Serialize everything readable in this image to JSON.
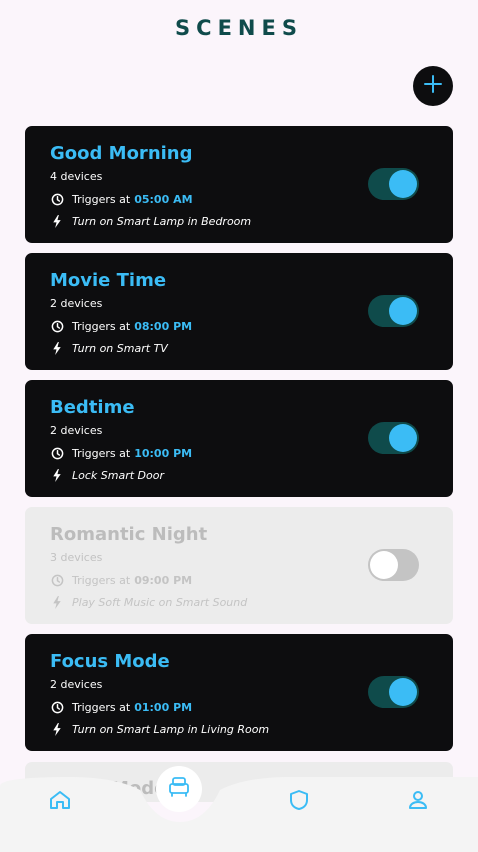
{
  "header": {
    "title": "SCENES"
  },
  "add_button": {
    "icon": "plus-icon",
    "label": "+"
  },
  "colors": {
    "accent": "#3bbcf5",
    "card_bg": "#0d0d0f",
    "toggle_on_track": "#0f4b4b",
    "disabled_bg": "#ececec"
  },
  "scenes": [
    {
      "name": "Good Morning",
      "devices": "4 devices",
      "trigger_prefix": "Triggers at",
      "time": "05:00 AM",
      "action": "Turn on Smart Lamp in Bedroom",
      "enabled": true
    },
    {
      "name": "Movie Time",
      "devices": "2 devices",
      "trigger_prefix": "Triggers at",
      "time": "08:00 PM",
      "action": "Turn on Smart TV",
      "enabled": true
    },
    {
      "name": "Bedtime",
      "devices": "2 devices",
      "trigger_prefix": "Triggers at",
      "time": "10:00 PM",
      "action": "Lock Smart Door",
      "enabled": true
    },
    {
      "name": "Romantic Night",
      "devices": "3 devices",
      "trigger_prefix": "Triggers at",
      "time": "09:00 PM",
      "action": "Play Soft Music on Smart Sound",
      "enabled": false
    },
    {
      "name": "Focus Mode",
      "devices": "2 devices",
      "trigger_prefix": "Triggers at",
      "time": "01:00 PM",
      "action": "Turn on Smart Lamp in Living Room",
      "enabled": true
    }
  ],
  "partial_card": {
    "name": "Mode"
  },
  "nav": {
    "items": [
      {
        "icon": "home-icon"
      },
      {
        "icon": "sofa-icon",
        "active": true
      },
      {
        "icon": "shield-icon"
      },
      {
        "icon": "user-icon"
      }
    ]
  }
}
